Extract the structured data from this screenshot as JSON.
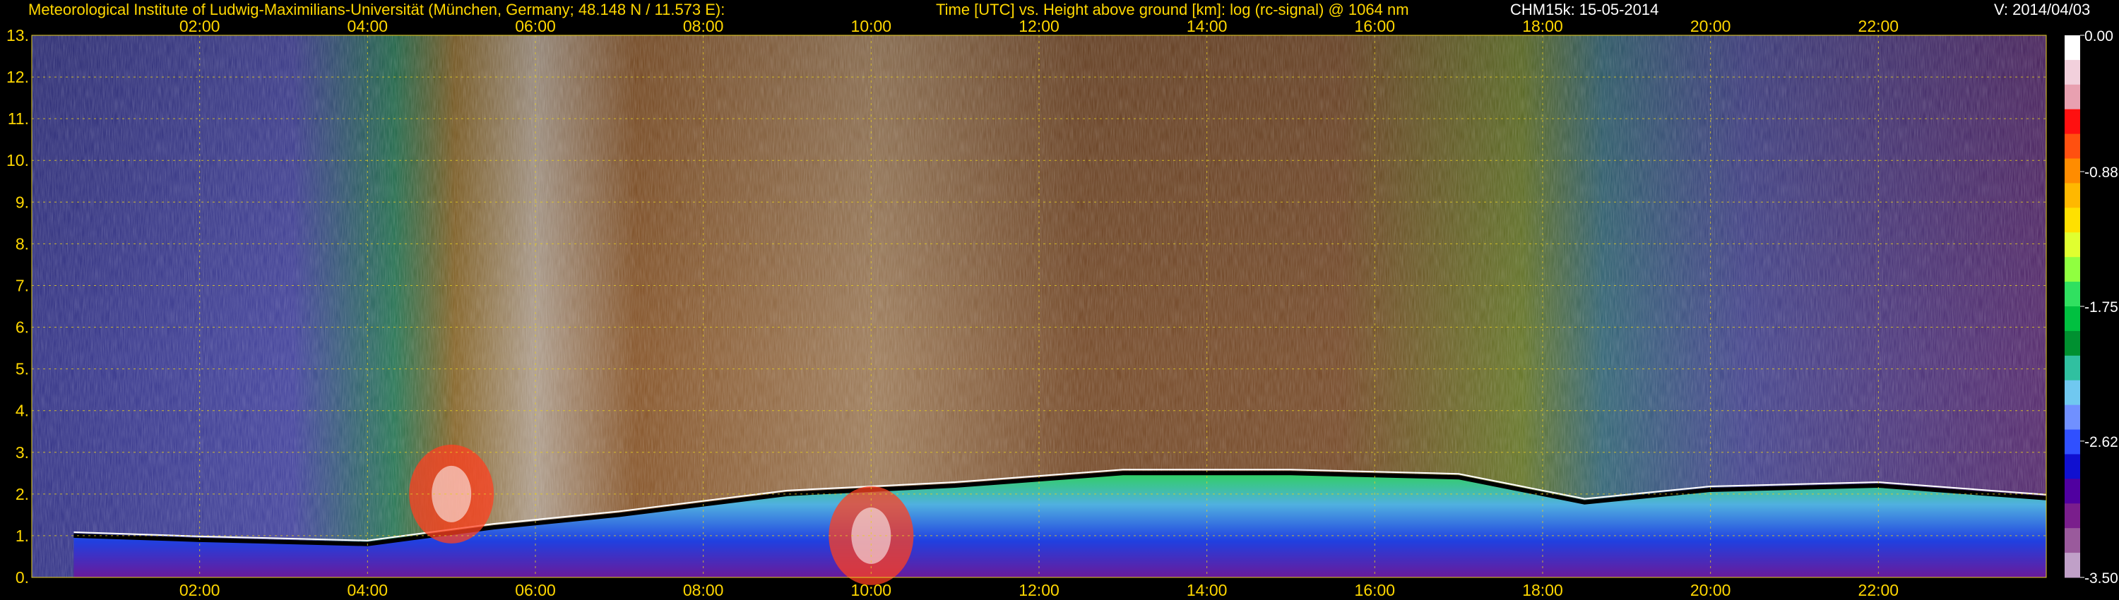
{
  "header": {
    "institute": "Meteorological Institute of Ludwig-Maximilians-Universität (München, Germany; 48.148 N / 11.573 E):",
    "plot_desc": "Time [UTC] vs. Height above ground [km]: log (rc-signal) @ 1064 nm",
    "instrument_date": "CHM15k: 15-05-2014",
    "version": "V: 2014/04/03"
  },
  "chart_data": {
    "type": "heatmap",
    "title": "Time [UTC] vs. Height above ground [km]: log (rc-signal) @ 1064 nm",
    "xlabel": "Time [UTC]",
    "ylabel": "Height above ground [km]",
    "x_ticks": [
      "02:00",
      "04:00",
      "06:00",
      "08:00",
      "10:00",
      "12:00",
      "14:00",
      "16:00",
      "18:00",
      "20:00",
      "22:00"
    ],
    "x_tick_hours": [
      2,
      4,
      6,
      8,
      10,
      12,
      14,
      16,
      18,
      20,
      22
    ],
    "xlim": [
      0,
      24
    ],
    "y_ticks": [
      "0.",
      "1.",
      "2.",
      "3.",
      "4.",
      "5.",
      "6.",
      "7.",
      "8.",
      "9.",
      "10.",
      "11.",
      "12.",
      "13."
    ],
    "ylim": [
      0,
      13
    ],
    "grid": true,
    "colorbar": {
      "ticks": [
        "0.00",
        "-0.88",
        "-1.75",
        "-2.62",
        "-3.50"
      ],
      "range": [
        -3.5,
        0.0
      ],
      "colors": [
        "#ffffff",
        "#f2d0dc",
        "#e8a0b0",
        "#ff1010",
        "#ff5010",
        "#ff8c00",
        "#ffb800",
        "#ffe000",
        "#e0ff30",
        "#90ff40",
        "#30e060",
        "#00c040",
        "#009030",
        "#30c0a0",
        "#70c8f0",
        "#7090ff",
        "#3050ff",
        "#1010d0",
        "#5000a0",
        "#7a1e8c",
        "#9a5a9c",
        "#c0a0c8"
      ]
    },
    "features": {
      "boundary_layer_top_km": [
        {
          "time": 0.5,
          "height": 1.0
        },
        {
          "time": 2.0,
          "height": 0.9
        },
        {
          "time": 4.0,
          "height": 0.8
        },
        {
          "time": 5.5,
          "height": 1.2
        },
        {
          "time": 7.0,
          "height": 1.5
        },
        {
          "time": 9.0,
          "height": 2.0
        },
        {
          "time": 11.0,
          "height": 2.2
        },
        {
          "time": 13.0,
          "height": 2.5
        },
        {
          "time": 15.0,
          "height": 2.5
        },
        {
          "time": 17.0,
          "height": 2.4
        },
        {
          "time": 18.5,
          "height": 1.8
        },
        {
          "time": 20.0,
          "height": 2.1
        },
        {
          "time": 22.0,
          "height": 2.2
        },
        {
          "time": 24.0,
          "height": 1.9
        }
      ],
      "cloud_events": [
        {
          "time": 5.0,
          "height": 2.0
        },
        {
          "time": 10.0,
          "height": 1.0
        }
      ]
    }
  }
}
